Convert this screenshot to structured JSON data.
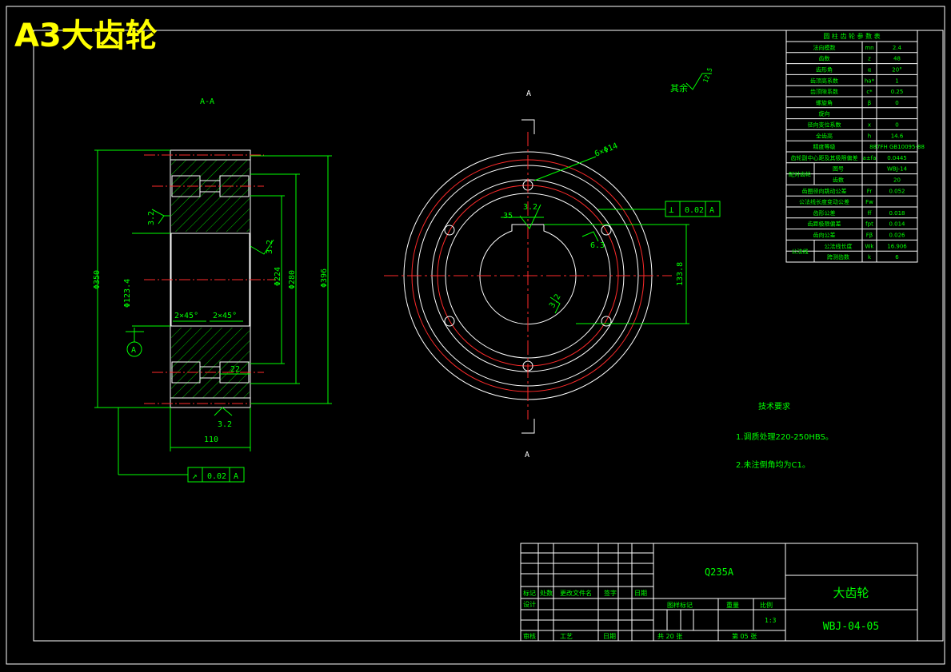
{
  "sheet": {
    "title": "A3大齿轮",
    "section_label": "A-A",
    "view_mark": "A",
    "datum_symbol": "A",
    "roughness_note": "其余",
    "roughness_value": "12.5"
  },
  "section_view": {
    "dims": {
      "d350": "Φ350",
      "d396": "Φ396",
      "d280": "Φ280",
      "d224": "Φ224",
      "d123": "Φ123.4",
      "width": "110",
      "groove": "22",
      "chamfer_left": "2×45°",
      "chamfer_right": "2×45°",
      "ra_left": "3.2",
      "ra_right": "3.2",
      "ra_bottom": "3.2"
    },
    "tolerance": {
      "symbol": "↗",
      "value": "0.02",
      "datum": "A"
    }
  },
  "front_view": {
    "holes_label": "6×Φ14",
    "key_width": "35",
    "key_depth": "133.8",
    "ra_key": "3.2",
    "ra_bore": "3.2",
    "ra_side": "6.3",
    "tolerance": {
      "symbol": "⊥",
      "value": "0.02",
      "datum": "A"
    }
  },
  "param_table": {
    "title": "圆 柱 齿 轮 参 数 表",
    "rows": [
      {
        "name": "法向模数",
        "sym": "mn",
        "val": "2.4"
      },
      {
        "name": "齿数",
        "sym": "z",
        "val": "48"
      },
      {
        "name": "齿形角",
        "sym": "α",
        "val": "20°"
      },
      {
        "name": "齿顶高系数",
        "sym": "ha*",
        "val": "1"
      },
      {
        "name": "齿顶隙系数",
        "sym": "c*",
        "val": "0.25"
      },
      {
        "name": "螺旋角",
        "sym": "β",
        "val": "0"
      },
      {
        "name": "旋向",
        "sym": "",
        "val": ""
      },
      {
        "name": "径向变位系数",
        "sym": "x",
        "val": "0"
      },
      {
        "name": "全齿高",
        "sym": "h",
        "val": "14.6"
      },
      {
        "name": "精度等级",
        "sym": "",
        "val": "887FH GB10095-88"
      },
      {
        "name": "齿轮副中心距及其极限偏差",
        "sym": "a±fa",
        "val": "0.0445"
      },
      {
        "name": "图号",
        "sym": "",
        "val": "WBJ-14",
        "group": "配对齿轮"
      },
      {
        "name": "齿数",
        "sym": "",
        "val": "20",
        "group": ""
      },
      {
        "name": "齿圈径向跳动公差",
        "sym": "Fr",
        "val": "0.052"
      },
      {
        "name": "公法线长度变动公差",
        "sym": "Fw",
        "val": ""
      },
      {
        "name": "齿形公差",
        "sym": "ff",
        "val": "0.018"
      },
      {
        "name": "齿距极限偏差",
        "sym": "fpt",
        "val": "0.014"
      },
      {
        "name": "齿向公差",
        "sym": "Fβ",
        "val": "0.026"
      },
      {
        "name": "公法线长度",
        "sym": "Wk",
        "val": "16.906",
        "group": "公法线"
      },
      {
        "name": "跨测齿数",
        "sym": "k",
        "val": "6",
        "group": ""
      }
    ]
  },
  "tech_req": {
    "title": "技术要求",
    "items": [
      "1.调质处理220-250HBS。",
      "2.未注倒角均为C1。"
    ]
  },
  "title_block": {
    "material": "Q235A",
    "part_name": "大齿轮",
    "drawing_no": "WBJ-04-05",
    "h_mark": "标记",
    "h_count": "处数",
    "h_doc": "更改文件名",
    "h_sign": "签字",
    "h_date": "日期",
    "h_design": "设计",
    "h_review": "审核",
    "h_craft": "工艺",
    "h_date2": "日期",
    "h_stage": "图样标记",
    "h_weight": "重量",
    "h_scale": "比例",
    "scale": "1:3",
    "sheets": "共 20 张",
    "sheet_no": "第 05 张"
  }
}
